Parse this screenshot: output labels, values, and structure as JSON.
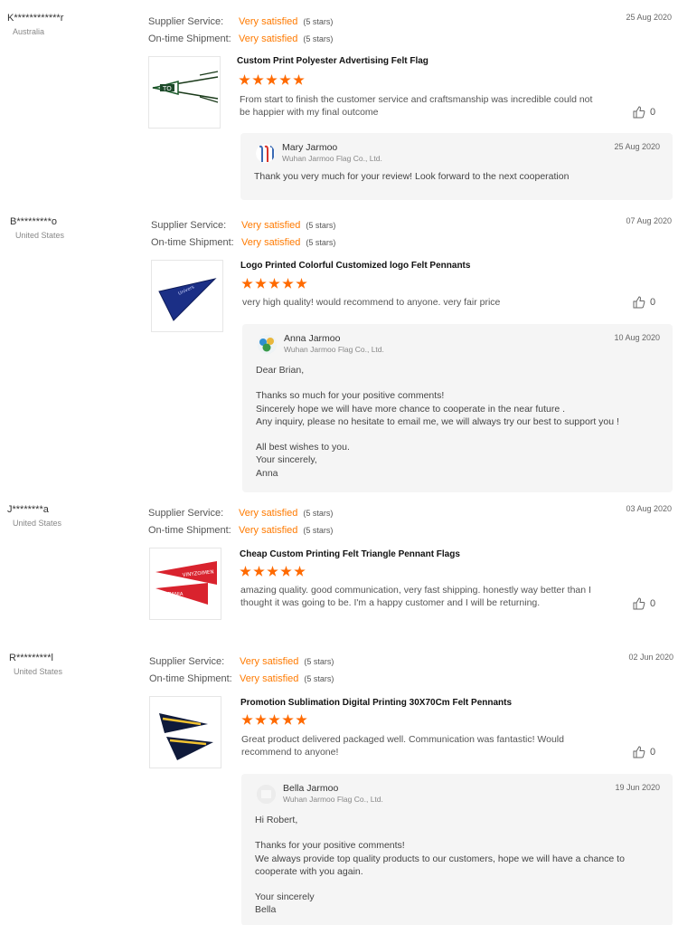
{
  "labels": {
    "supplier_service": "Supplier Service:",
    "ontime_shipment": "On-time Shipment:"
  },
  "colors": {
    "accent": "#ff7a00",
    "star": "#ff6a00",
    "reply_bg": "#f5f5f5"
  },
  "reviews": [
    {
      "buyer": "K************r",
      "country": "Australia",
      "date": "25 Aug 2020",
      "supplier_service": {
        "value": "Very satisfied",
        "stars": "(5 stars)"
      },
      "ontime_shipment": {
        "value": "Very satisfied",
        "stars": "(5 stars)"
      },
      "product_title": "Custom Print Polyester Advertising Felt Flag",
      "rating": 5,
      "comment": "From start to finish the customer service and craftsmanship was incredible could not be happier with my final outcome",
      "likes": "0",
      "reply": {
        "name": "Mary Jarmoo",
        "company": "Wuhan Jarmoo Flag Co., Ltd.",
        "date": "25 Aug 2020",
        "lines": [
          "Thank you very much for your review! Look forward to the next cooperation"
        ]
      }
    },
    {
      "buyer": "B*********o",
      "country": "United States",
      "date": "07 Aug 2020",
      "supplier_service": {
        "value": "Very satisfied",
        "stars": "(5 stars)"
      },
      "ontime_shipment": {
        "value": "Very satisfied",
        "stars": "(5 stars)"
      },
      "product_title": "Logo Printed Colorful Customized logo Felt Pennants",
      "rating": 5,
      "comment": "very high quality! would recommend to anyone. very fair price",
      "likes": "0",
      "reply": {
        "name": "Anna Jarmoo",
        "company": "Wuhan Jarmoo Flag Co., Ltd.",
        "date": "10 Aug 2020",
        "lines": [
          "Dear Brian,",
          "",
          "Thanks so much for your positive comments!",
          "Sincerely hope we will have more chance to cooperate in the near future .",
          "Any inquiry, please no hesitate to email me, we will always try our best to support you !",
          "",
          "All best wishes to you.",
          "Your sincerely,",
          "Anna"
        ]
      }
    },
    {
      "buyer": "J********a",
      "country": "United States",
      "date": "03 Aug 2020",
      "supplier_service": {
        "value": "Very satisfied",
        "stars": "(5 stars)"
      },
      "ontime_shipment": {
        "value": "Very satisfied",
        "stars": "(5 stars)"
      },
      "product_title": "Cheap Custom Printing Felt Triangle Pennant Flags",
      "rating": 5,
      "comment": "amazing quality. good communication, very fast shipping.  honestly way better than I thought it was going to be. I'm a happy customer and I will be returning.",
      "likes": "0",
      "product_image_text": [
        "VINYZOIMEN",
        "KIDZANIA"
      ]
    },
    {
      "buyer": "R*********l",
      "country": "United States",
      "date": "02 Jun 2020",
      "supplier_service": {
        "value": "Very satisfied",
        "stars": "(5 stars)"
      },
      "ontime_shipment": {
        "value": "Very satisfied",
        "stars": "(5 stars)"
      },
      "product_title": "Promotion Sublimation Digital Printing 30X70Cm Felt Pennants",
      "rating": 5,
      "comment": "Great product delivered packaged well.  Communication was fantastic!  Would recommend to anyone!",
      "likes": "0",
      "reply": {
        "name": "Bella Jarmoo",
        "company": "Wuhan Jarmoo Flag Co., Ltd.",
        "date": "19 Jun 2020",
        "lines": [
          "Hi Robert,",
          "",
          "Thanks for your positive comments!",
          "We always provide top quality products to our customers, hope we will have a chance to cooperate with you again.",
          "",
          "Your sincerely",
          "Bella"
        ]
      }
    }
  ]
}
